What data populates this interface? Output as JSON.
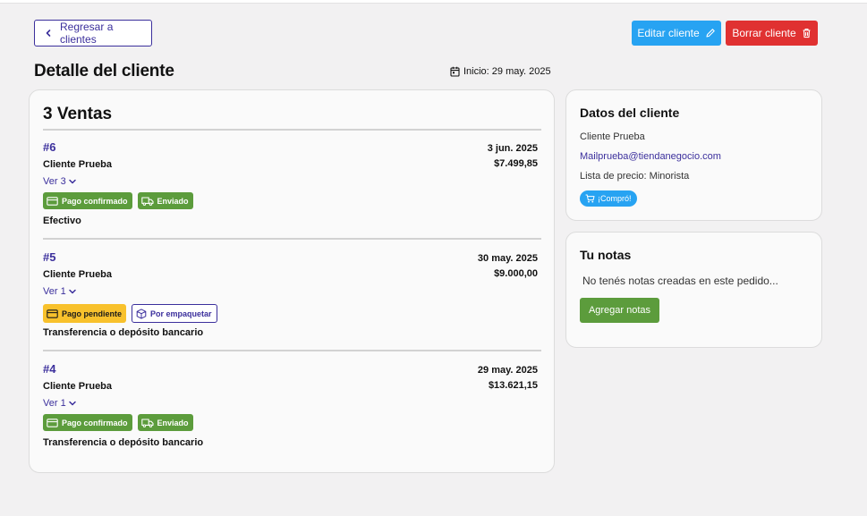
{
  "header": {
    "back_label": "Regresar a clientes",
    "edit_label": "Editar cliente",
    "delete_label": "Borrar cliente",
    "title": "Detalle del cliente",
    "start_date": "Inicio: 29 may. 2025"
  },
  "sales": {
    "title": "3 Ventas",
    "items": [
      {
        "id": "#6",
        "date": "3 jun. 2025",
        "client": "Cliente Prueba",
        "total": "$7.499,85",
        "ver": "Ver 3",
        "payment_badge": "Pago confirmado",
        "shipping_badge": "Enviado",
        "method": "Efectivo"
      },
      {
        "id": "#5",
        "date": "30 may. 2025",
        "client": "Cliente Prueba",
        "total": "$9.000,00",
        "ver": "Ver 1",
        "payment_badge": "Pago pendiente",
        "shipping_badge": "Por empaquetar",
        "method": "Transferencia o depósito bancario"
      },
      {
        "id": "#4",
        "date": "29 may. 2025",
        "client": "Cliente Prueba",
        "total": "$13.621,15",
        "ver": "Ver 1",
        "payment_badge": "Pago confirmado",
        "shipping_badge": "Enviado",
        "method": "Transferencia o depósito bancario"
      }
    ]
  },
  "client": {
    "title": "Datos del cliente",
    "name": "Cliente Prueba",
    "email": "Mailprueba@tiendanegocio.com",
    "price_list": "Lista de precio: Minorista",
    "bought_pill": "¡Compró!"
  },
  "notes": {
    "title": "Tu notas",
    "empty_text": "No tenés notas creadas en este pedido...",
    "add_label": "Agregar notas"
  },
  "colors": {
    "accent": "#3b2f9c",
    "edit": "#27a3f2",
    "delete": "#e03131",
    "success": "#5c9c3c",
    "pending": "#f8c12c"
  },
  "icons": [
    "chevron-left-icon",
    "pencil-icon",
    "trash-icon",
    "calendar-icon",
    "chevron-down-icon",
    "credit-card-icon",
    "truck-icon",
    "box-icon",
    "cart-icon"
  ]
}
